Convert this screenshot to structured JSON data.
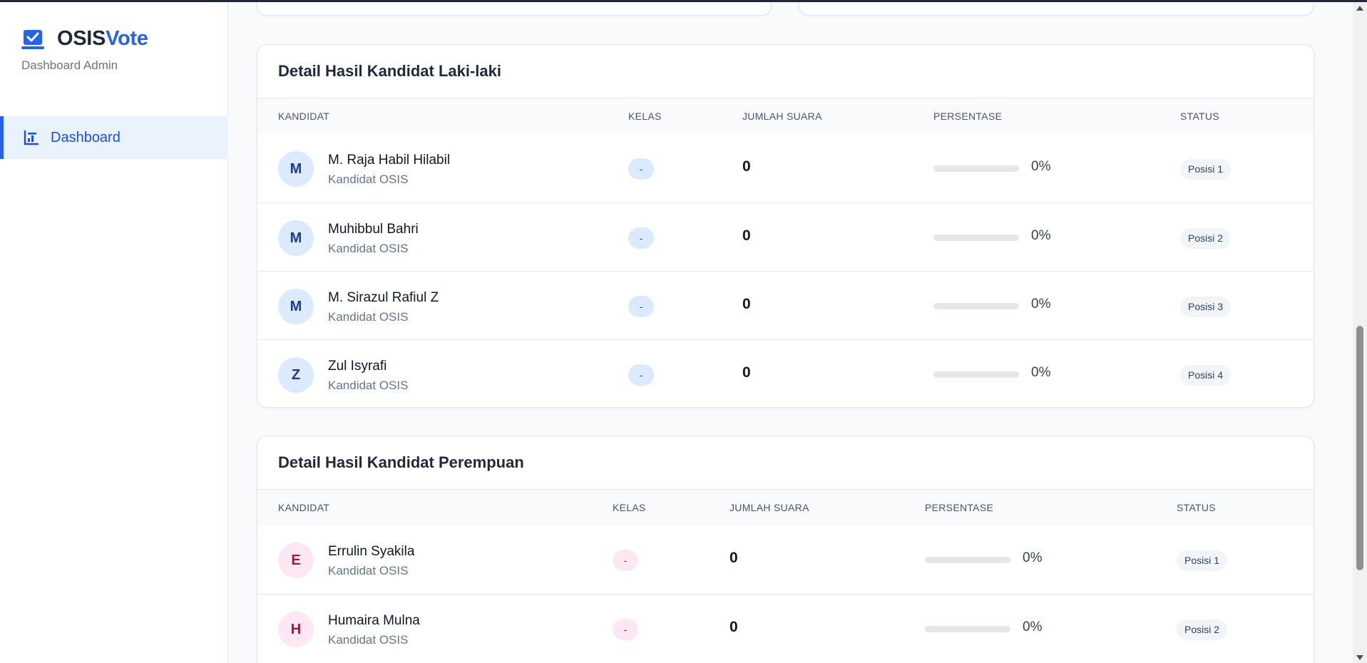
{
  "app": {
    "brand_part1": "OSIS",
    "brand_part2": "Vote",
    "subtitle": "Dashboard Admin",
    "accent_color": "#2563eb"
  },
  "sidebar": {
    "items": [
      {
        "label": "Dashboard",
        "icon": "chart-bar-icon",
        "active": true
      }
    ]
  },
  "columns": {
    "kandidat": "KANDIDAT",
    "kelas": "KELAS",
    "suara": "JUMLAH SUARA",
    "persentase": "PERSENTASE",
    "status": "STATUS"
  },
  "male_section": {
    "title": "Detail Hasil Kandidat Laki-laki",
    "rows": [
      {
        "initial": "M",
        "name": "M. Raja Habil Hilabil",
        "role": "Kandidat OSIS",
        "kelas": "-",
        "votes": "0",
        "percent": "0%",
        "percent_value": 0,
        "status": "Posisi 1"
      },
      {
        "initial": "M",
        "name": "Muhibbul Bahri",
        "role": "Kandidat OSIS",
        "kelas": "-",
        "votes": "0",
        "percent": "0%",
        "percent_value": 0,
        "status": "Posisi 2"
      },
      {
        "initial": "M",
        "name": "M. Sirazul Rafiul Z",
        "role": "Kandidat OSIS",
        "kelas": "-",
        "votes": "0",
        "percent": "0%",
        "percent_value": 0,
        "status": "Posisi 3"
      },
      {
        "initial": "Z",
        "name": "Zul Isyrafi",
        "role": "Kandidat OSIS",
        "kelas": "-",
        "votes": "0",
        "percent": "0%",
        "percent_value": 0,
        "status": "Posisi 4"
      }
    ]
  },
  "female_section": {
    "title": "Detail Hasil Kandidat Perempuan",
    "rows": [
      {
        "initial": "E",
        "name": "Errulin Syakila",
        "role": "Kandidat OSIS",
        "kelas": "-",
        "votes": "0",
        "percent": "0%",
        "percent_value": 0,
        "status": "Posisi 1"
      },
      {
        "initial": "H",
        "name": "Humaira Mulna",
        "role": "Kandidat OSIS",
        "kelas": "-",
        "votes": "0",
        "percent": "0%",
        "percent_value": 0,
        "status": "Posisi 2"
      }
    ]
  }
}
